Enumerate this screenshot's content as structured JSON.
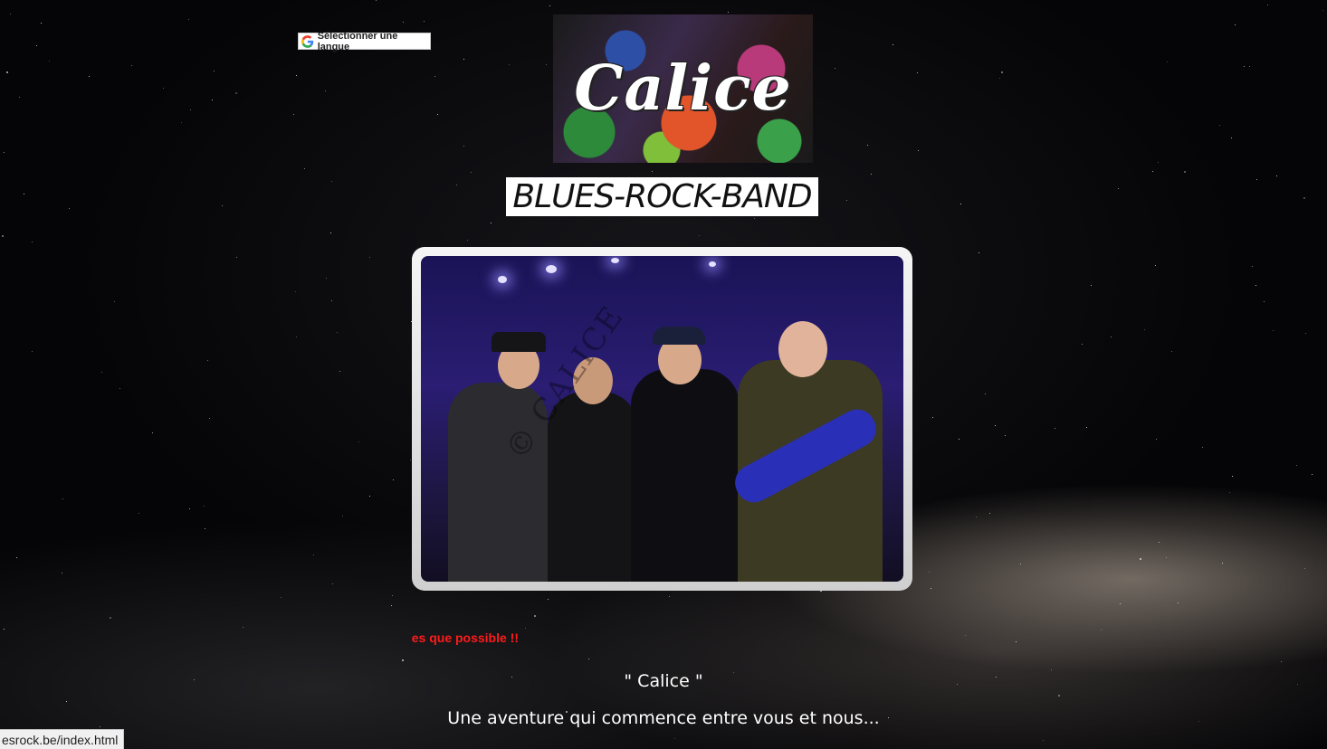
{
  "language_widget": {
    "label": "Sélectionner une langue",
    "icon": "google-g-icon"
  },
  "logo": {
    "text": "Calice"
  },
  "tagline": "BLUES-ROCK-BAND",
  "photo": {
    "watermark": "© CALICE",
    "description_icon": "band-photo"
  },
  "marquee": {
    "visible_text": "es que possible !!",
    "color": "#ff1a1a"
  },
  "content": {
    "title": "\" Calice \"",
    "intro": "Une aventure qui commence entre vous et nous..."
  },
  "status_bar": {
    "url": "esrock.be/index.html"
  }
}
